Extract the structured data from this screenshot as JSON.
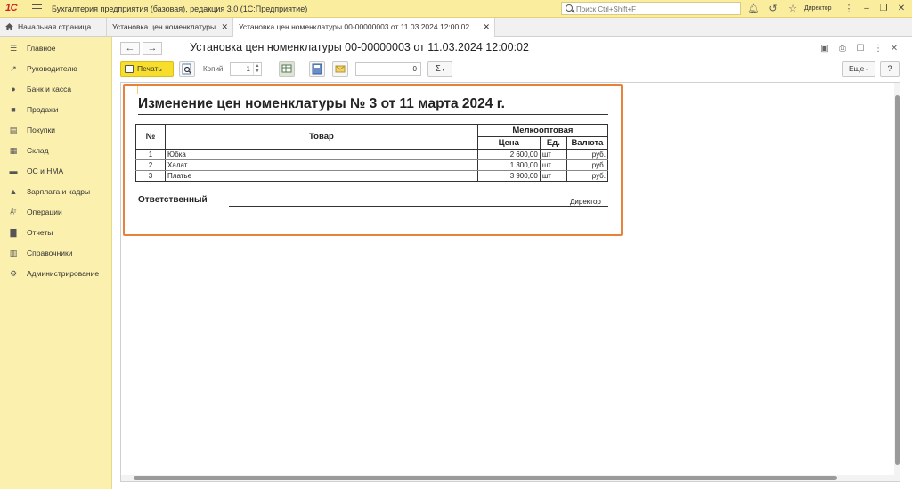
{
  "app": {
    "logo_text": "1С",
    "title": "Бухгалтерия предприятия (базовая), редакция 3.0  (1С:Предприятие)",
    "search_placeholder": "Поиск Ctrl+Shift+F",
    "user": "Директор"
  },
  "tabs": {
    "home": "Начальная страница",
    "items": [
      {
        "label": "Установка цен номенклатуры"
      },
      {
        "label": "Установка цен номенклатуры 00-00000003 от 11.03.2024 12:00:02"
      }
    ]
  },
  "sidebar": {
    "items": [
      {
        "label": "Главное",
        "icon": "menu-icon"
      },
      {
        "label": "Руководителю",
        "icon": "trend-icon"
      },
      {
        "label": "Банк и касса",
        "icon": "coin-icon"
      },
      {
        "label": "Продажи",
        "icon": "bag-icon"
      },
      {
        "label": "Покупки",
        "icon": "cart-icon"
      },
      {
        "label": "Склад",
        "icon": "warehouse-icon"
      },
      {
        "label": "ОС и НМА",
        "icon": "truck-icon"
      },
      {
        "label": "Зарплата и кадры",
        "icon": "person-icon"
      },
      {
        "label": "Операции",
        "icon": "debit-credit-icon"
      },
      {
        "label": "Отчеты",
        "icon": "bar-chart-icon"
      },
      {
        "label": "Справочники",
        "icon": "books-icon"
      },
      {
        "label": "Администрирование",
        "icon": "gear-icon"
      }
    ]
  },
  "document": {
    "title": "Установка цен номенклатуры 00-00000003 от 11.03.2024 12:00:02"
  },
  "toolbar": {
    "print_label": "Печать",
    "copies_label": "Копий:",
    "copies_value": "1",
    "sum_value": "0",
    "sum_symbol": "Σ",
    "more_label": "Еще",
    "help_label": "?"
  },
  "report": {
    "title": "Изменение цен номенклатуры № 3 от 11 марта 2024 г.",
    "headers": {
      "num": "№",
      "product": "Товар",
      "group": "Мелкооптовая",
      "price": "Цена",
      "unit": "Ед.",
      "currency": "Валюта"
    },
    "rows": [
      {
        "num": "1",
        "name": "Юбка",
        "price": "2 600,00",
        "unit": "шт",
        "currency": "руб."
      },
      {
        "num": "2",
        "name": "Халат",
        "price": "1 300,00",
        "unit": "шт",
        "currency": "руб."
      },
      {
        "num": "3",
        "name": "Платье",
        "price": "3 900,00",
        "unit": "шт",
        "currency": "руб."
      }
    ],
    "responsible_label": "Ответственный",
    "responsible_position": "Директор"
  },
  "colors": {
    "topbar": "#fbed9e",
    "sidebar": "#fbf0ae",
    "print_button": "#f7de2c",
    "highlight": "#e8823a"
  }
}
